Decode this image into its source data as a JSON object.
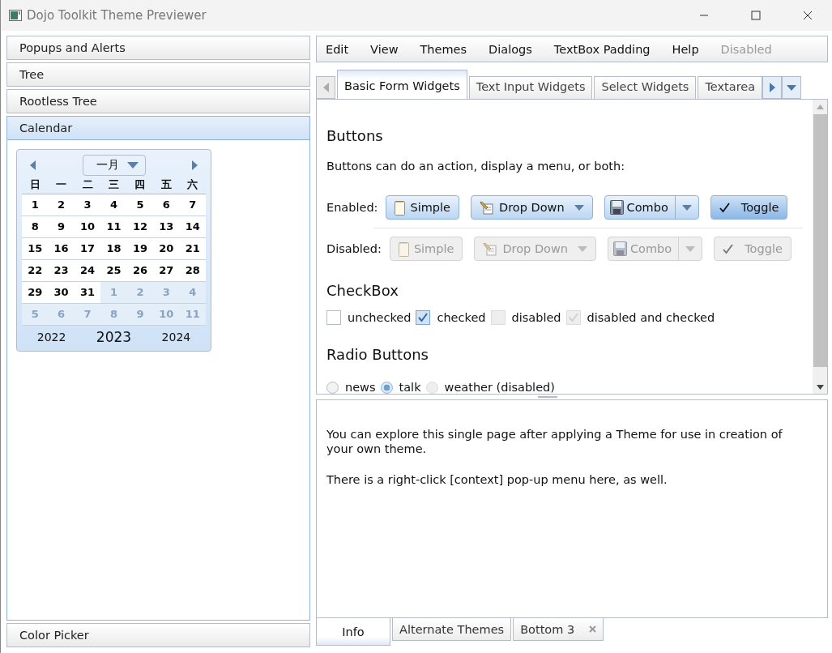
{
  "window": {
    "title": "Dojo Toolkit Theme Previewer"
  },
  "accordion": [
    {
      "label": "Popups and Alerts",
      "selected": false
    },
    {
      "label": "Tree",
      "selected": false
    },
    {
      "label": "Rootless Tree",
      "selected": false
    },
    {
      "label": "Calendar",
      "selected": true
    }
  ],
  "accordion_bottom": {
    "label": "Color Picker",
    "selected": false
  },
  "calendar": {
    "month": "一月",
    "weekdays": [
      "日",
      "一",
      "二",
      "三",
      "四",
      "五",
      "六"
    ],
    "weeks": [
      [
        {
          "day": "1",
          "current": true
        },
        {
          "day": "2",
          "current": true
        },
        {
          "day": "3",
          "current": true
        },
        {
          "day": "4",
          "current": true
        },
        {
          "day": "5",
          "current": true
        },
        {
          "day": "6",
          "current": true
        },
        {
          "day": "7",
          "current": true
        }
      ],
      [
        {
          "day": "8",
          "current": true
        },
        {
          "day": "9",
          "current": true
        },
        {
          "day": "10",
          "current": true
        },
        {
          "day": "11",
          "current": true
        },
        {
          "day": "12",
          "current": true
        },
        {
          "day": "13",
          "current": true
        },
        {
          "day": "14",
          "current": true
        }
      ],
      [
        {
          "day": "15",
          "current": true
        },
        {
          "day": "16",
          "current": true
        },
        {
          "day": "17",
          "current": true
        },
        {
          "day": "18",
          "current": true
        },
        {
          "day": "19",
          "current": true
        },
        {
          "day": "20",
          "current": true
        },
        {
          "day": "21",
          "current": true
        }
      ],
      [
        {
          "day": "22",
          "current": true
        },
        {
          "day": "23",
          "current": true
        },
        {
          "day": "24",
          "current": true
        },
        {
          "day": "25",
          "current": true
        },
        {
          "day": "26",
          "current": true
        },
        {
          "day": "27",
          "current": true
        },
        {
          "day": "28",
          "current": true
        }
      ],
      [
        {
          "day": "29",
          "current": true
        },
        {
          "day": "30",
          "current": true
        },
        {
          "day": "31",
          "current": true
        },
        {
          "day": "1",
          "current": false
        },
        {
          "day": "2",
          "current": false
        },
        {
          "day": "3",
          "current": false
        },
        {
          "day": "4",
          "current": false
        }
      ],
      [
        {
          "day": "5",
          "current": false
        },
        {
          "day": "6",
          "current": false
        },
        {
          "day": "7",
          "current": false
        },
        {
          "day": "8",
          "current": false
        },
        {
          "day": "9",
          "current": false
        },
        {
          "day": "10",
          "current": false
        },
        {
          "day": "11",
          "current": false
        }
      ]
    ],
    "years": {
      "previous": "2022",
      "current": "2023",
      "next": "2024"
    }
  },
  "menu": [
    {
      "label": "Edit",
      "disabled": false
    },
    {
      "label": "View",
      "disabled": false
    },
    {
      "label": "Themes",
      "disabled": false
    },
    {
      "label": "Dialogs",
      "disabled": false
    },
    {
      "label": "TextBox Padding",
      "disabled": false
    },
    {
      "label": "Help",
      "disabled": false
    },
    {
      "label": "Disabled",
      "disabled": true
    }
  ],
  "tabs": [
    {
      "label": "Basic Form Widgets",
      "selected": true
    },
    {
      "label": "Text Input Widgets",
      "selected": false
    },
    {
      "label": "Select Widgets",
      "selected": false
    },
    {
      "label": "Textarea",
      "selected": false
    }
  ],
  "buttons_section": {
    "heading": "Buttons",
    "description": "Buttons can do an action, display a menu, or both:",
    "rows": [
      {
        "label": "Enabled:",
        "disabled": false,
        "buttons": [
          {
            "kind": "simple",
            "label": "Simple"
          },
          {
            "kind": "dropdown",
            "label": "Drop Down"
          },
          {
            "kind": "combo",
            "label": "Combo"
          },
          {
            "kind": "toggle",
            "label": "Toggle",
            "checked": true
          }
        ]
      },
      {
        "label": "Disabled:",
        "disabled": true,
        "buttons": [
          {
            "kind": "simple",
            "label": "Simple"
          },
          {
            "kind": "dropdown",
            "label": "Drop Down"
          },
          {
            "kind": "combo",
            "label": "Combo"
          },
          {
            "kind": "toggle",
            "label": "Toggle"
          }
        ]
      }
    ]
  },
  "checkbox_section": {
    "heading": "CheckBox",
    "items": [
      {
        "label": "unchecked",
        "checked": false,
        "disabled": false
      },
      {
        "label": "checked",
        "checked": true,
        "disabled": false
      },
      {
        "label": "disabled",
        "checked": false,
        "disabled": true
      },
      {
        "label": "disabled and checked",
        "checked": true,
        "disabled": true
      }
    ]
  },
  "radio_section": {
    "heading": "Radio Buttons",
    "items": [
      {
        "label": "news",
        "selected": false,
        "disabled": false
      },
      {
        "label": "talk",
        "selected": true,
        "disabled": false
      },
      {
        "label": "weather (disabled)",
        "selected": false,
        "disabled": true
      }
    ]
  },
  "info": {
    "paragraphs": [
      "You can explore this single page after applying a Theme for use in creation of your own theme.",
      "There is a right-click [context] pop-up menu here, as well."
    ]
  },
  "bottom_tabs": [
    {
      "label": "Info",
      "selected": true,
      "closable": false
    },
    {
      "label": "Alternate Themes",
      "selected": false,
      "closable": false
    },
    {
      "label": "Bottom 3",
      "selected": false,
      "closable": true
    }
  ]
}
